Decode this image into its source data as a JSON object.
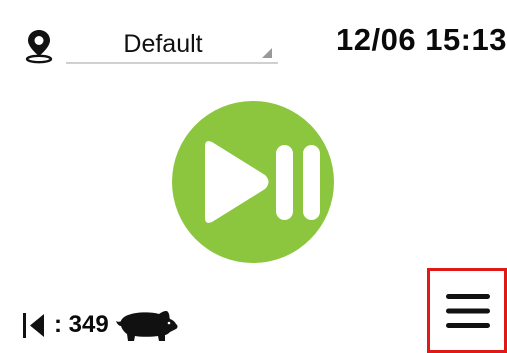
{
  "header": {
    "location_icon": "map-pin-icon",
    "profile_select": {
      "value": "Default"
    },
    "datetime": "12/06 15:13"
  },
  "main": {
    "play_pause_icon": "play-pause-icon",
    "accent_color": "#8cc63f"
  },
  "footer": {
    "counter": {
      "icon": "back-bar-icon",
      "value": ": 349",
      "animal_icon": "pig-icon"
    },
    "menu_button": {
      "icon": "hamburger-menu-icon",
      "highlight_color": "#e01818"
    }
  }
}
